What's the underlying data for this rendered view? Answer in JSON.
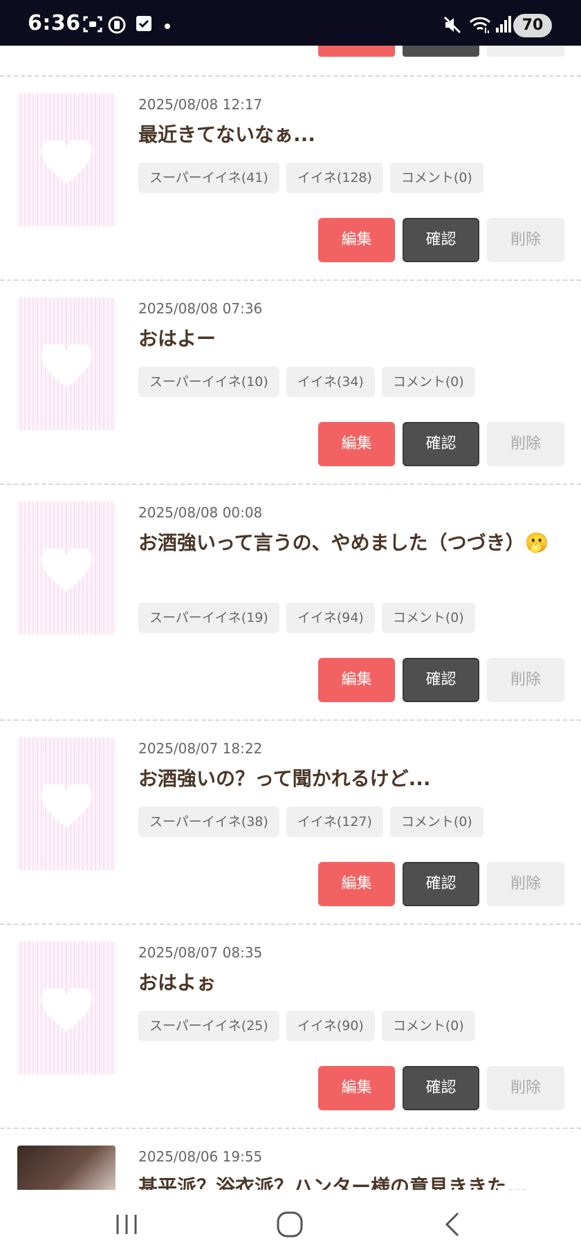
{
  "status_bar": {
    "time": "6:36",
    "battery": "70",
    "icons": [
      "screenshot-icon",
      "sim-icon",
      "checkbox-icon",
      "notification-dot",
      "mute-icon",
      "wifi-icon",
      "signal-icon",
      "battery-icon"
    ]
  },
  "buttons": {
    "edit": "編集",
    "confirm": "確認",
    "delete": "削除"
  },
  "posts": [
    {
      "date": "2025/08/08 12:17",
      "title": "最近きてないなぁ...",
      "super_like": "スーパーイイネ(41)",
      "like": "イイネ(128)",
      "comment": "コメント(0)"
    },
    {
      "date": "2025/08/08 07:36",
      "title": "おはよー",
      "super_like": "スーパーイイネ(10)",
      "like": "イイネ(34)",
      "comment": "コメント(0)"
    },
    {
      "date": "2025/08/08 00:08",
      "title": "お酒強いって言うの、やめました（つづき）🫢",
      "super_like": "スーパーイイネ(19)",
      "like": "イイネ(94)",
      "comment": "コメント(0)"
    },
    {
      "date": "2025/08/07 18:22",
      "title": "お酒強いの？って聞かれるけど...",
      "super_like": "スーパーイイネ(38)",
      "like": "イイネ(127)",
      "comment": "コメント(0)"
    },
    {
      "date": "2025/08/07 08:35",
      "title": "おはよぉ",
      "super_like": "スーパーイイネ(25)",
      "like": "イイネ(90)",
      "comment": "コメント(0)"
    },
    {
      "date": "2025/08/06 19:55",
      "title": "甚平派？浴衣派？ハンター様の意見ききた..."
    }
  ],
  "nav_bar": {
    "icons": [
      "recent-apps-icon",
      "home-icon",
      "back-icon"
    ]
  }
}
